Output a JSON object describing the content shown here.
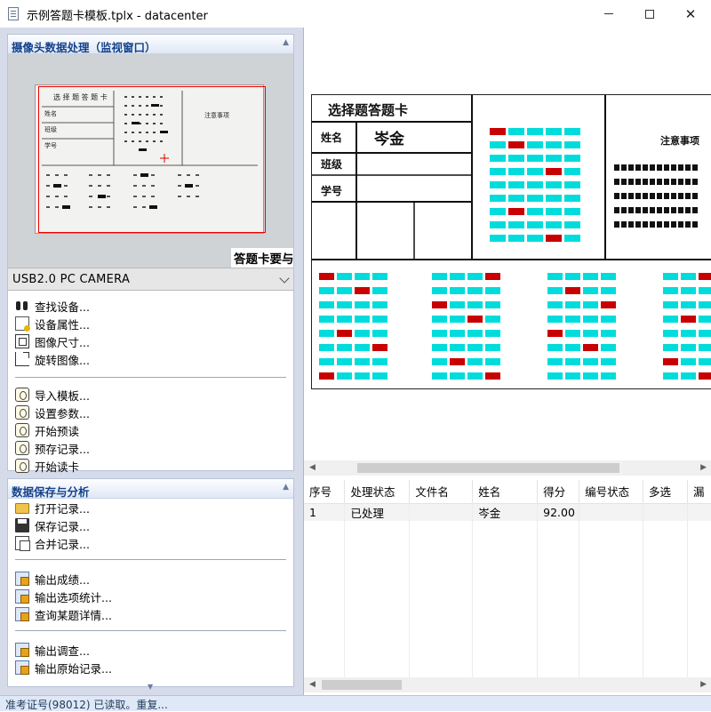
{
  "window": {
    "title": "示例答题卡模板.tplx - datacenter",
    "min_icon": "minimize-icon",
    "max_icon": "maximize-icon",
    "close_glyph": "✕"
  },
  "camera_group": {
    "title": "摄像头数据处理（监视窗口）",
    "preview_banner": "答题卡要与",
    "device": "USB2.0 PC CAMERA",
    "items": [
      {
        "label": "查找设备...",
        "icon": "binoculars-icon"
      },
      {
        "label": "设备属性...",
        "icon": "properties-icon"
      },
      {
        "label": "图像尺寸...",
        "icon": "image-size-icon"
      },
      {
        "label": "旋转图像...",
        "icon": "rotate-icon"
      },
      {
        "label": "导入模板...",
        "icon": "import-template-icon"
      },
      {
        "label": "设置参数...",
        "icon": "settings-icon"
      },
      {
        "label": "开始预读",
        "icon": "preread-icon"
      },
      {
        "label": "预存记录...",
        "icon": "prestore-icon"
      },
      {
        "label": "开始读卡",
        "icon": "read-card-icon"
      }
    ]
  },
  "data_group": {
    "title": "数据保存与分析",
    "items": [
      {
        "label": "打开记录...",
        "icon": "folder-open-icon"
      },
      {
        "label": "保存记录...",
        "icon": "save-icon"
      },
      {
        "label": "合并记录...",
        "icon": "merge-icon"
      },
      {
        "label": "输出成绩...",
        "icon": "export-icon"
      },
      {
        "label": "输出选项统计...",
        "icon": "export-icon"
      },
      {
        "label": "查询某题详情...",
        "icon": "export-icon"
      },
      {
        "label": "输出调查...",
        "icon": "export-icon"
      },
      {
        "label": "输出原始记录...",
        "icon": "export-icon"
      }
    ]
  },
  "sheet": {
    "header_cells": [
      "选择题答题卡"
    ],
    "field_labels": [
      "姓名",
      "班级",
      "学号"
    ],
    "name_value": "岑金",
    "notes_title": "注意事项"
  },
  "results_table": {
    "columns": [
      "序号",
      "处理状态",
      "文件名",
      "姓名",
      "得分",
      "编号状态",
      "多选",
      "漏"
    ],
    "rows": [
      [
        "1",
        "已处理",
        "",
        "岑金",
        "92.00",
        "",
        "",
        ""
      ]
    ]
  },
  "status_bar": {
    "text": "准考证号(98012) 已读取。重复..."
  },
  "colors": {
    "group_title": "#15428b",
    "mark_fill": "#00dcdc",
    "mark_selected": "#c80000",
    "roi_border": "#e00000"
  }
}
